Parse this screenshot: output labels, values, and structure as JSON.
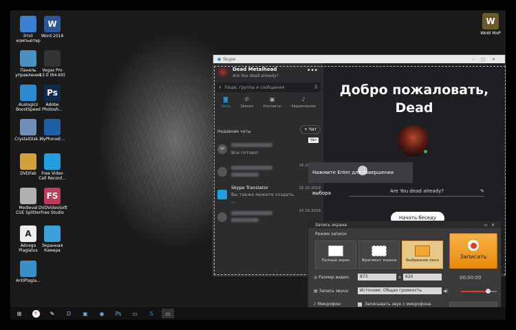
{
  "desktop_icons": [
    {
      "name": "this-pc",
      "label": "Этот компьютер",
      "icon": "computer-icon",
      "color": "#3b7fd1"
    },
    {
      "name": "word",
      "label": "Word 2016",
      "icon": "word-icon",
      "color": "#2b579a",
      "glyph": "W"
    },
    {
      "name": "control-panel",
      "label": "Панель управления",
      "icon": "control-panel-icon",
      "color": "#4a90c0"
    },
    {
      "name": "vegas",
      "label": "Vegas Pro 13.0 (64-bit)",
      "icon": "vegas-icon",
      "color": "#333"
    },
    {
      "name": "auslogics",
      "label": "Auslogics BoostSpeed",
      "icon": "boostspeed-icon",
      "color": "#2c8ad1"
    },
    {
      "name": "photoshop",
      "label": "Adobe Photosh...",
      "icon": "photoshop-icon",
      "color": "#0d2b4d",
      "glyph": "Ps"
    },
    {
      "name": "crystaldisk",
      "label": "CrystalDisk...",
      "icon": "crystaldisk-icon",
      "color": "#6f8fb8"
    },
    {
      "name": "myphone",
      "label": "MyPhoneE...",
      "icon": "myphone-icon",
      "color": "#1e5fa8"
    },
    {
      "name": "dvdfab",
      "label": "DVDFab",
      "icon": "dvdfab-icon",
      "color": "#d2a23a"
    },
    {
      "name": "free-video",
      "label": "Free Video Call Record...",
      "icon": "skype-recorder-icon",
      "color": "#1ea0e0"
    },
    {
      "name": "medieval",
      "label": "Medieval CUE Splitter",
      "icon": "cue-splitter-icon",
      "color": "#b0b0b0"
    },
    {
      "name": "fs-studio",
      "label": "DVDVideoSoft Free Studio",
      "icon": "free-studio-icon",
      "color": "#c03a5b",
      "glyph": "FS"
    },
    {
      "name": "advego",
      "label": "Advego Plagiatus",
      "icon": "advego-icon",
      "color": "#eee",
      "glyph": "A"
    },
    {
      "name": "screen-camera",
      "label": "Экранная Камера",
      "icon": "screen-camera-icon",
      "color": "#3aa0d8"
    },
    {
      "name": "antiplagiat",
      "label": "AntiPlagia...",
      "icon": "antiplagiat-icon",
      "color": "#3a8fc8"
    },
    {
      "name": "wow",
      "label": "WoW MoP",
      "icon": "wow-icon",
      "color": "#6b5a2a",
      "glyph": "W"
    }
  ],
  "skype": {
    "window_title": "Skype",
    "profile_name": "Dead Metalhead",
    "profile_status": "Are You dead already?",
    "search_placeholder": "Люди, группы и сообщения",
    "nav": [
      {
        "label": "Чаты",
        "icon": "chat-icon"
      },
      {
        "label": "Звонки",
        "icon": "phone-icon"
      },
      {
        "label": "Контакты",
        "icon": "contacts-icon"
      },
      {
        "label": "Уведомления",
        "icon": "bell-icon"
      }
    ],
    "recent_label": "Недавние чаты",
    "new_chat_label": "+ Чат",
    "tooltip": "Чат",
    "chats": [
      {
        "initials": "SP",
        "preview": "Все готово!",
        "date": "",
        "blurred": true
      },
      {
        "name": "",
        "preview": "",
        "date": "16.10.2019",
        "blurred": true
      },
      {
        "name": "Skype Translator",
        "preview": "Вы также можете создать ...",
        "date": "16.10.2019",
        "blurred": false
      },
      {
        "name": "",
        "preview": "",
        "date": "15.10.2019",
        "blurred": true
      }
    ],
    "welcome_line1": "Добро пожаловать,",
    "welcome_line2": "Dead",
    "mood_text": "Are You dead already?",
    "start_button": "Начать беседу"
  },
  "capture_hint": "Нажмите Enter для завершения выбора",
  "recorder": {
    "title": "Запись экрана",
    "mode_label": "Режим записи:",
    "modes": [
      "Полный экран",
      "Фрагмент экрана",
      "Выбранное окно"
    ],
    "record_button": "Записать",
    "size_label": "Размер видео:",
    "width": "873",
    "height": "620",
    "timer": "00:00:00",
    "audio_label": "Запись звука:",
    "audio_source": "Источник: Общая громкость",
    "volume": 0.75,
    "mic_label": "Микрофон:",
    "mic_checkbox": "Записывать звук с микрофона"
  },
  "accent": "#e23b2a"
}
